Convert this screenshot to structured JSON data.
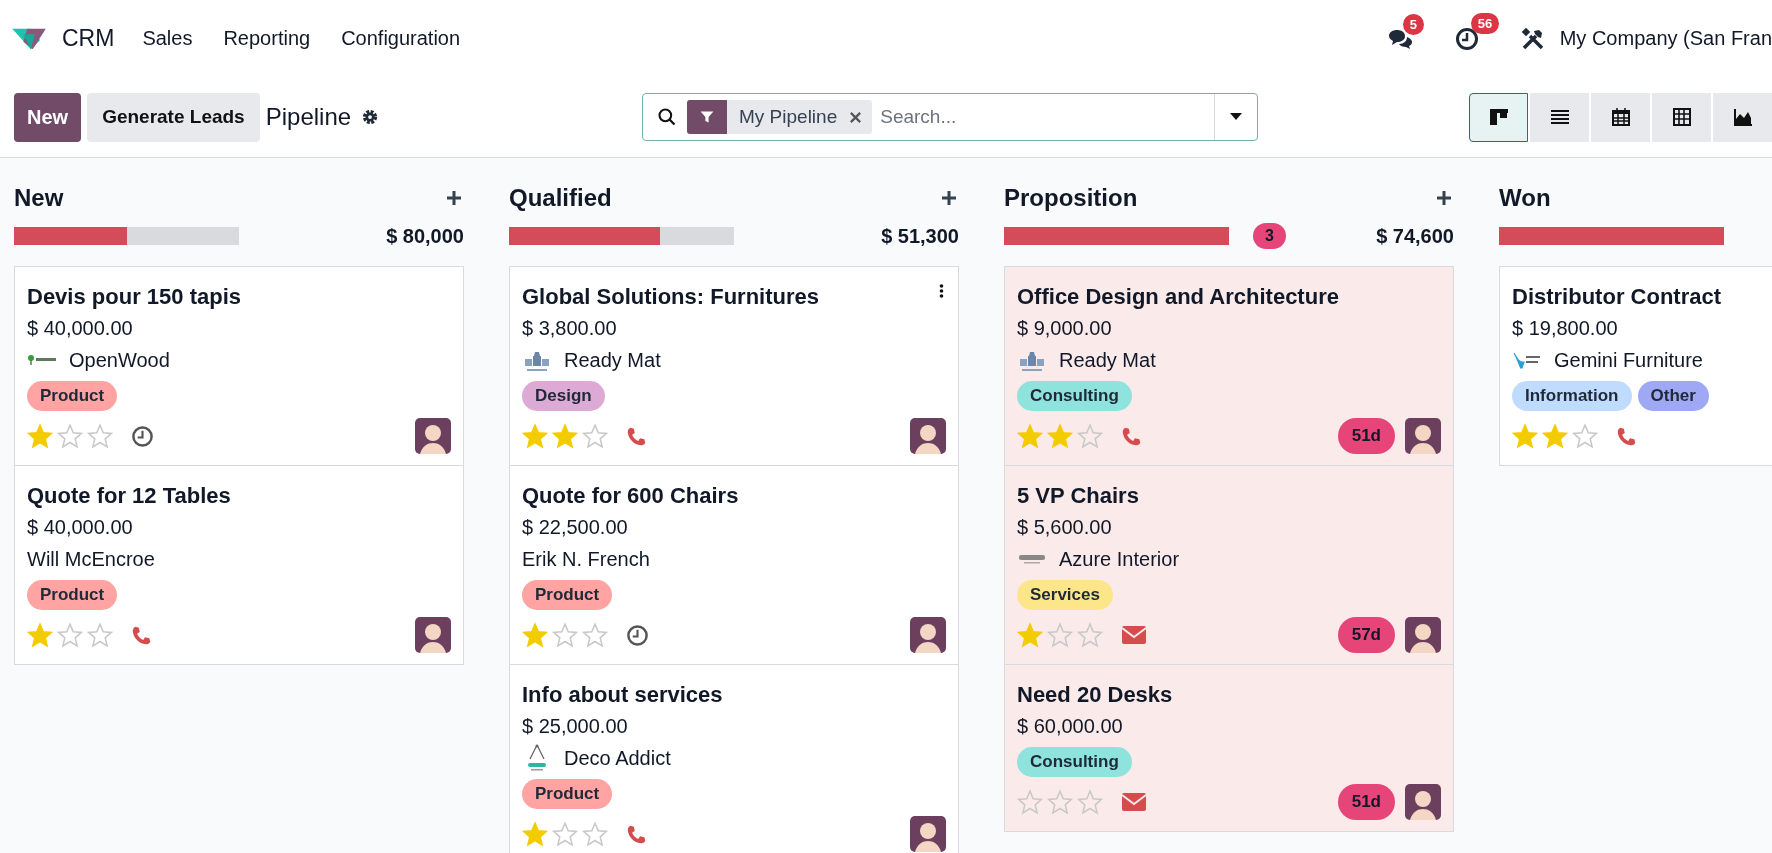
{
  "navbar": {
    "app": "CRM",
    "menu": [
      "Sales",
      "Reporting",
      "Configuration"
    ],
    "messages_count": "5",
    "activities_count": "56",
    "company": "My Company (San Fran"
  },
  "control_panel": {
    "new_button": "New",
    "generate_button": "Generate Leads",
    "title": "Pipeline",
    "facet": "My Pipeline",
    "search_placeholder": "Search...",
    "views": [
      {
        "kind": "kanban",
        "selected": true
      },
      {
        "kind": "list",
        "selected": false
      },
      {
        "kind": "calendar",
        "selected": false
      },
      {
        "kind": "pivot",
        "selected": false
      },
      {
        "kind": "graph",
        "selected": false
      }
    ]
  },
  "columns": [
    {
      "title": "New",
      "level": 0.5,
      "total": "$ 80,000",
      "cards": [
        {
          "title": "Devis pour 150 tapis",
          "amount": "$ 40,000.00",
          "partner": "OpenWood",
          "logo": {
            "kind": "tree"
          },
          "tags": [
            {
              "label": "Product",
              "color": "#ffa3a3"
            }
          ],
          "stars": 1,
          "activity": {
            "kind": "clock"
          }
        },
        {
          "title": "Quote for 12 Tables",
          "amount": "$ 40,000.00",
          "partner": "Will McEncroe",
          "tags": [
            {
              "label": "Product",
              "color": "#ffa3a3"
            }
          ],
          "stars": 1,
          "activity": {
            "kind": "phone"
          }
        }
      ]
    },
    {
      "title": "Qualified",
      "level": 0.67,
      "total": "$ 51,300",
      "cards": [
        {
          "title": "Global Solutions: Furnitures",
          "amount": "$ 3,800.00",
          "partner": "Ready Mat",
          "logo": {
            "kind": "building"
          },
          "tags": [
            {
              "label": "Design",
              "color": "#dcaad4"
            }
          ],
          "stars": 2,
          "activity": {
            "kind": "phone"
          },
          "menu": true
        },
        {
          "title": "Quote for 600 Chairs",
          "amount": "$ 22,500.00",
          "partner": "Erik N. French",
          "tags": [
            {
              "label": "Product",
              "color": "#ffa3a3"
            }
          ],
          "stars": 1,
          "activity": {
            "kind": "clock"
          }
        },
        {
          "title": "Info about services",
          "amount": "$ 25,000.00",
          "partner": "Deco Addict",
          "logo": {
            "kind": "compass"
          },
          "tags": [
            {
              "label": "Product",
              "color": "#ffa3a3"
            }
          ],
          "stars": 1,
          "activity": {
            "kind": "phone"
          }
        }
      ]
    },
    {
      "title": "Proposition",
      "level": 1,
      "count": "3",
      "total": "$ 74,600",
      "cards": [
        {
          "title": "Office Design and Architecture",
          "amount": "$ 9,000.00",
          "partner": "Ready Mat",
          "logo": {
            "kind": "building"
          },
          "tags": [
            {
              "label": "Consulting",
              "color": "#8ee3dd"
            }
          ],
          "stars": 2,
          "activity": {
            "kind": "phone"
          },
          "days": "51d"
        },
        {
          "title": "5 VP Chairs",
          "amount": "$ 5,600.00",
          "partner": "Azure Interior",
          "logo": {
            "kind": "wordmark"
          },
          "tags": [
            {
              "label": "Services",
              "color": "#fde68a"
            }
          ],
          "stars": 1,
          "activity": {
            "kind": "email"
          },
          "days": "57d"
        },
        {
          "title": "Need 20 Desks",
          "amount": "$ 60,000.00",
          "tags": [
            {
              "label": "Consulting",
              "color": "#8ee3dd"
            }
          ],
          "stars": 0,
          "activity": {
            "kind": "email"
          },
          "days": "51d"
        }
      ]
    },
    {
      "title": "Won",
      "level": 1,
      "cards": [
        {
          "title": "Distributor Contract",
          "amount": "$ 19,800.00",
          "partner": "Gemini Furniture",
          "logo": {
            "kind": "chair"
          },
          "tags": [
            {
              "label": "Information",
              "color": "#bfdbfe"
            },
            {
              "label": "Other",
              "color": "#9fa8f5"
            }
          ],
          "stars": 2,
          "activity": {
            "kind": "phone"
          }
        }
      ]
    }
  ]
}
